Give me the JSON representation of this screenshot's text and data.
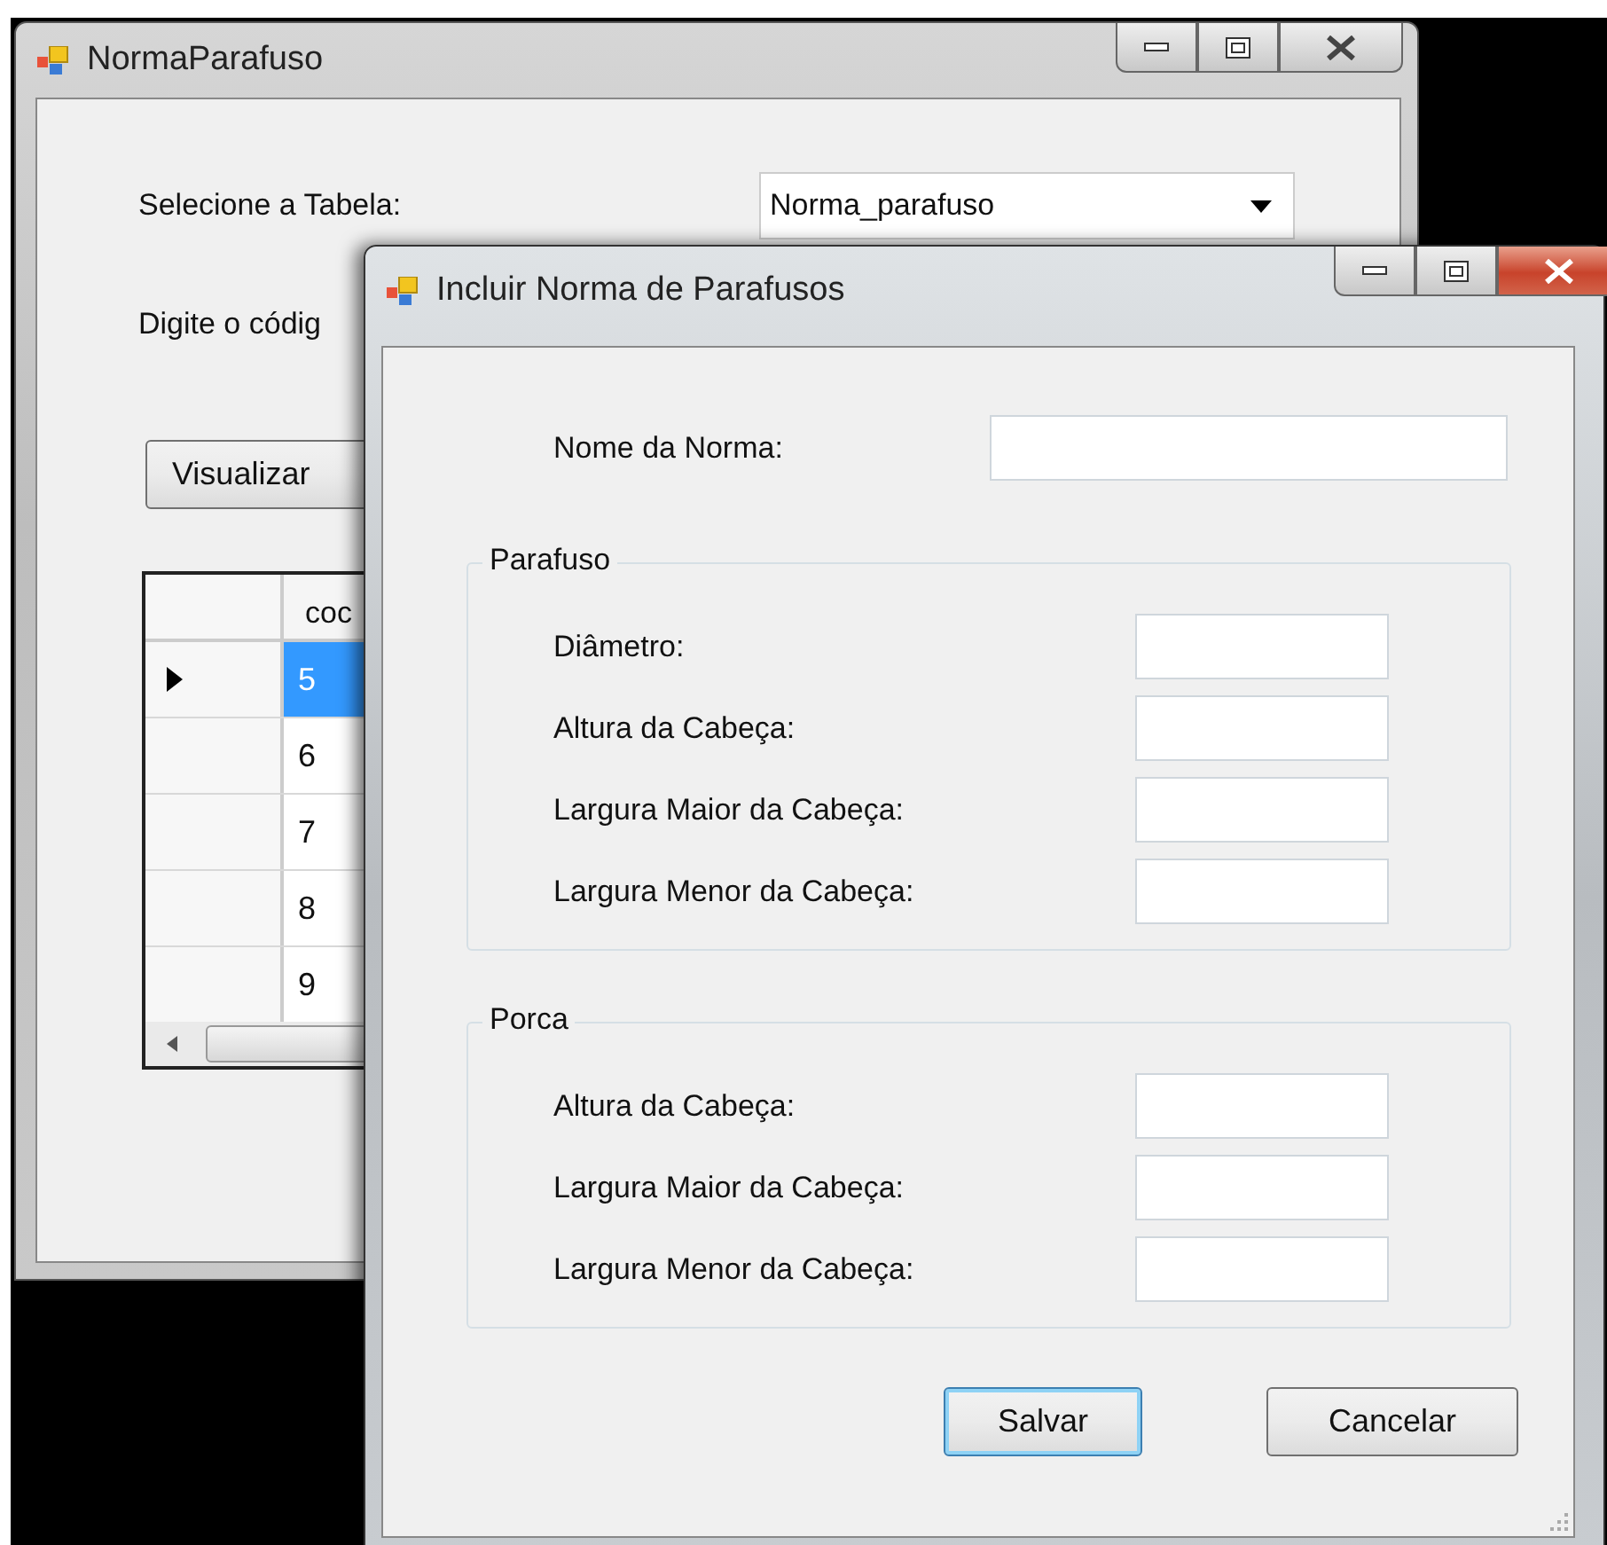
{
  "main_window": {
    "title": "NormaParafuso",
    "active": false,
    "table_label": "Selecione a Tabela:",
    "table_select": {
      "value": "Norma_parafuso"
    },
    "code_label": "Digite o códig",
    "view_button": "Visualizar",
    "grid": {
      "columns": [
        "coc"
      ],
      "rows": [
        {
          "cell": "5",
          "selected": true
        },
        {
          "cell": "6",
          "selected": false
        },
        {
          "cell": "7",
          "selected": false
        },
        {
          "cell": "8",
          "selected": false
        },
        {
          "cell": "9",
          "selected": false
        }
      ]
    }
  },
  "dialog": {
    "title": "Incluir Norma de Parafusos",
    "active": true,
    "name_label": "Nome da Norma:",
    "groups": [
      {
        "title": "Parafuso",
        "fields": [
          {
            "label": "Diâmetro:"
          },
          {
            "label": "Altura da Cabeça:"
          },
          {
            "label": "Largura Maior da Cabeça:"
          },
          {
            "label": "Largura Menor da Cabeça:"
          }
        ]
      },
      {
        "title": "Porca",
        "fields": [
          {
            "label": "Altura da Cabeça:"
          },
          {
            "label": "Largura Maior da Cabeça:"
          },
          {
            "label": "Largura Menor da Cabeça:"
          }
        ]
      }
    ],
    "buttons": [
      {
        "label": "Salvar",
        "default": true
      },
      {
        "label": "Cancelar",
        "default": false
      }
    ]
  }
}
